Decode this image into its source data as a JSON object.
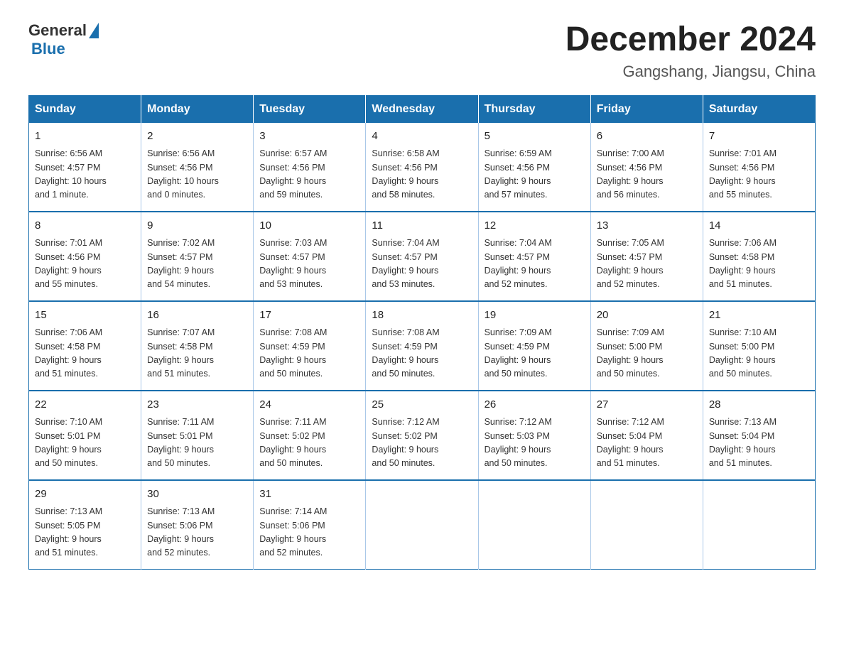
{
  "header": {
    "logo_general": "General",
    "logo_blue": "Blue",
    "month_title": "December 2024",
    "location": "Gangshang, Jiangsu, China"
  },
  "weekdays": [
    "Sunday",
    "Monday",
    "Tuesday",
    "Wednesday",
    "Thursday",
    "Friday",
    "Saturday"
  ],
  "weeks": [
    [
      {
        "day": "1",
        "info": "Sunrise: 6:56 AM\nSunset: 4:57 PM\nDaylight: 10 hours\nand 1 minute."
      },
      {
        "day": "2",
        "info": "Sunrise: 6:56 AM\nSunset: 4:56 PM\nDaylight: 10 hours\nand 0 minutes."
      },
      {
        "day": "3",
        "info": "Sunrise: 6:57 AM\nSunset: 4:56 PM\nDaylight: 9 hours\nand 59 minutes."
      },
      {
        "day": "4",
        "info": "Sunrise: 6:58 AM\nSunset: 4:56 PM\nDaylight: 9 hours\nand 58 minutes."
      },
      {
        "day": "5",
        "info": "Sunrise: 6:59 AM\nSunset: 4:56 PM\nDaylight: 9 hours\nand 57 minutes."
      },
      {
        "day": "6",
        "info": "Sunrise: 7:00 AM\nSunset: 4:56 PM\nDaylight: 9 hours\nand 56 minutes."
      },
      {
        "day": "7",
        "info": "Sunrise: 7:01 AM\nSunset: 4:56 PM\nDaylight: 9 hours\nand 55 minutes."
      }
    ],
    [
      {
        "day": "8",
        "info": "Sunrise: 7:01 AM\nSunset: 4:56 PM\nDaylight: 9 hours\nand 55 minutes."
      },
      {
        "day": "9",
        "info": "Sunrise: 7:02 AM\nSunset: 4:57 PM\nDaylight: 9 hours\nand 54 minutes."
      },
      {
        "day": "10",
        "info": "Sunrise: 7:03 AM\nSunset: 4:57 PM\nDaylight: 9 hours\nand 53 minutes."
      },
      {
        "day": "11",
        "info": "Sunrise: 7:04 AM\nSunset: 4:57 PM\nDaylight: 9 hours\nand 53 minutes."
      },
      {
        "day": "12",
        "info": "Sunrise: 7:04 AM\nSunset: 4:57 PM\nDaylight: 9 hours\nand 52 minutes."
      },
      {
        "day": "13",
        "info": "Sunrise: 7:05 AM\nSunset: 4:57 PM\nDaylight: 9 hours\nand 52 minutes."
      },
      {
        "day": "14",
        "info": "Sunrise: 7:06 AM\nSunset: 4:58 PM\nDaylight: 9 hours\nand 51 minutes."
      }
    ],
    [
      {
        "day": "15",
        "info": "Sunrise: 7:06 AM\nSunset: 4:58 PM\nDaylight: 9 hours\nand 51 minutes."
      },
      {
        "day": "16",
        "info": "Sunrise: 7:07 AM\nSunset: 4:58 PM\nDaylight: 9 hours\nand 51 minutes."
      },
      {
        "day": "17",
        "info": "Sunrise: 7:08 AM\nSunset: 4:59 PM\nDaylight: 9 hours\nand 50 minutes."
      },
      {
        "day": "18",
        "info": "Sunrise: 7:08 AM\nSunset: 4:59 PM\nDaylight: 9 hours\nand 50 minutes."
      },
      {
        "day": "19",
        "info": "Sunrise: 7:09 AM\nSunset: 4:59 PM\nDaylight: 9 hours\nand 50 minutes."
      },
      {
        "day": "20",
        "info": "Sunrise: 7:09 AM\nSunset: 5:00 PM\nDaylight: 9 hours\nand 50 minutes."
      },
      {
        "day": "21",
        "info": "Sunrise: 7:10 AM\nSunset: 5:00 PM\nDaylight: 9 hours\nand 50 minutes."
      }
    ],
    [
      {
        "day": "22",
        "info": "Sunrise: 7:10 AM\nSunset: 5:01 PM\nDaylight: 9 hours\nand 50 minutes."
      },
      {
        "day": "23",
        "info": "Sunrise: 7:11 AM\nSunset: 5:01 PM\nDaylight: 9 hours\nand 50 minutes."
      },
      {
        "day": "24",
        "info": "Sunrise: 7:11 AM\nSunset: 5:02 PM\nDaylight: 9 hours\nand 50 minutes."
      },
      {
        "day": "25",
        "info": "Sunrise: 7:12 AM\nSunset: 5:02 PM\nDaylight: 9 hours\nand 50 minutes."
      },
      {
        "day": "26",
        "info": "Sunrise: 7:12 AM\nSunset: 5:03 PM\nDaylight: 9 hours\nand 50 minutes."
      },
      {
        "day": "27",
        "info": "Sunrise: 7:12 AM\nSunset: 5:04 PM\nDaylight: 9 hours\nand 51 minutes."
      },
      {
        "day": "28",
        "info": "Sunrise: 7:13 AM\nSunset: 5:04 PM\nDaylight: 9 hours\nand 51 minutes."
      }
    ],
    [
      {
        "day": "29",
        "info": "Sunrise: 7:13 AM\nSunset: 5:05 PM\nDaylight: 9 hours\nand 51 minutes."
      },
      {
        "day": "30",
        "info": "Sunrise: 7:13 AM\nSunset: 5:06 PM\nDaylight: 9 hours\nand 52 minutes."
      },
      {
        "day": "31",
        "info": "Sunrise: 7:14 AM\nSunset: 5:06 PM\nDaylight: 9 hours\nand 52 minutes."
      },
      {
        "day": "",
        "info": ""
      },
      {
        "day": "",
        "info": ""
      },
      {
        "day": "",
        "info": ""
      },
      {
        "day": "",
        "info": ""
      }
    ]
  ]
}
